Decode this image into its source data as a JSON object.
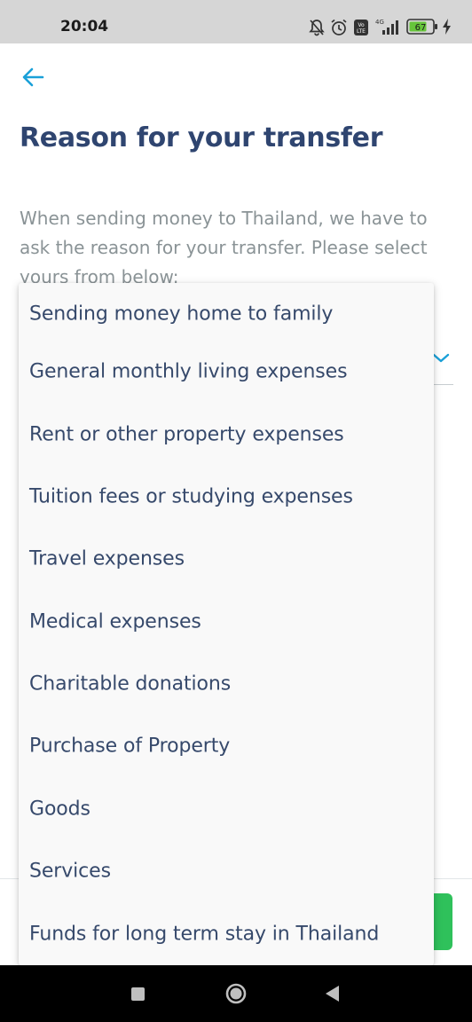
{
  "status_bar": {
    "time": "20:04",
    "battery": "67",
    "network": "4G"
  },
  "header": {
    "back_icon": "arrow-left-icon",
    "title": "Reason for your transfer"
  },
  "description": "When sending money to Thailand, we have to ask the reason for your transfer. Please select yours from below:",
  "dropdown": {
    "options": [
      "Sending money home to family",
      "General monthly living expenses",
      "Rent or other property expenses",
      "Tuition fees or studying expenses",
      "Travel expenses",
      "Medical expenses",
      "Charitable donations",
      "Purchase of Property",
      "Goods",
      "Services",
      "Funds for long term stay in Thailand"
    ]
  },
  "colors": {
    "title": "#2f4570",
    "accent": "#1aa0d8",
    "button": "#2fc15b"
  }
}
